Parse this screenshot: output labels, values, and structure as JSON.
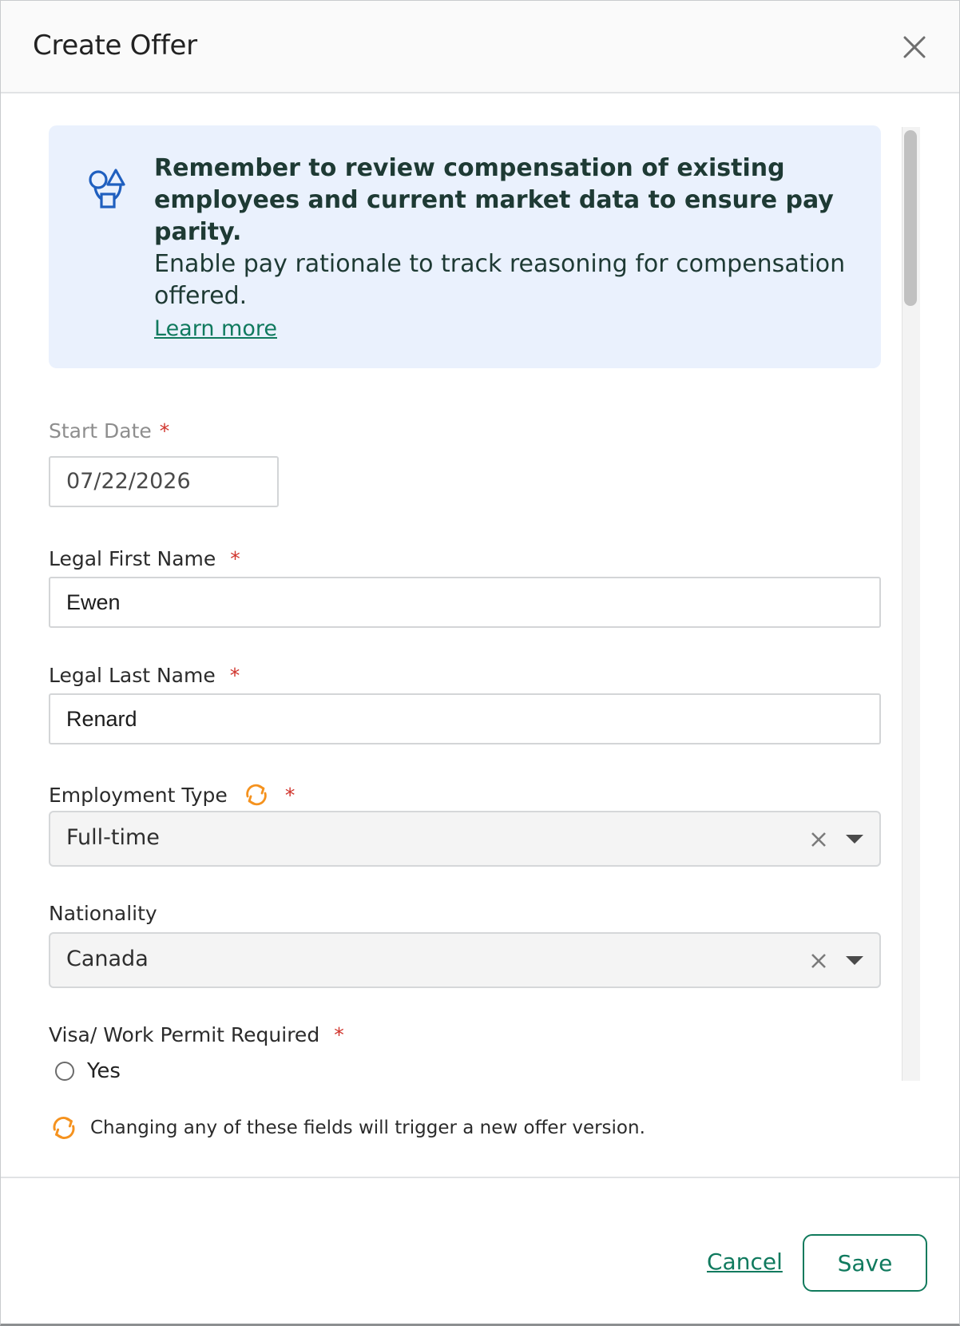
{
  "modal": {
    "title": "Create Offer"
  },
  "banner": {
    "bold_text": "Remember to review compensation of existing employees and current market data to ensure pay parity.",
    "body_text": "Enable pay rationale to track reasoning for compensation offered.",
    "link_text": "Learn more",
    "icon": "shapes-icon",
    "background": "#eaf1fd"
  },
  "form": {
    "start_date": {
      "label": "Start Date",
      "required": "*",
      "value": "07/22/2026"
    },
    "first_name": {
      "label": "Legal First Name",
      "required": "*",
      "value": "Ewen"
    },
    "last_name": {
      "label": "Legal Last Name",
      "required": "*",
      "value": "Renard"
    },
    "employment_type": {
      "label": "Employment Type",
      "required": "*",
      "value": "Full-time",
      "icon": "refresh-icon"
    },
    "nationality": {
      "label": "Nationality",
      "value": "Canada"
    },
    "visa": {
      "label": "Visa/ Work Permit Required",
      "required": "*",
      "option_yes": "Yes"
    }
  },
  "footer": {
    "note": "Changing any of these fields will trigger a new offer version.",
    "cancel_label": "Cancel",
    "save_label": "Save"
  },
  "colors": {
    "accent": "#107a5e",
    "warning_icon": "#f5921e",
    "required": "#d0342c"
  }
}
